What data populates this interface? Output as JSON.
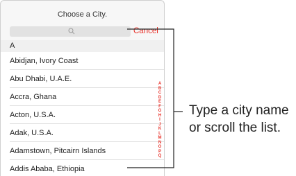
{
  "nav": {
    "title": "Choose a City."
  },
  "search": {
    "icon": "search-icon"
  },
  "cancel_label": "Cancel",
  "section_header": "A",
  "cities": [
    "Abidjan, Ivory Coast",
    "Abu Dhabi, U.A.E.",
    "Accra, Ghana",
    "Acton, U.S.A.",
    "Adak, U.S.A.",
    "Adamstown, Pitcairn Islands",
    "Addis Ababa, Ethiopia"
  ],
  "index_letters": [
    "A",
    "B",
    "C",
    "D",
    "E",
    "F",
    "G",
    "H",
    "I",
    "J",
    "K",
    "L",
    "M",
    "N",
    "O",
    "P",
    "Q"
  ],
  "callout": {
    "line1": "Type a city name",
    "line2": "or scroll the list."
  },
  "colors": {
    "accent": "#e8322a"
  }
}
